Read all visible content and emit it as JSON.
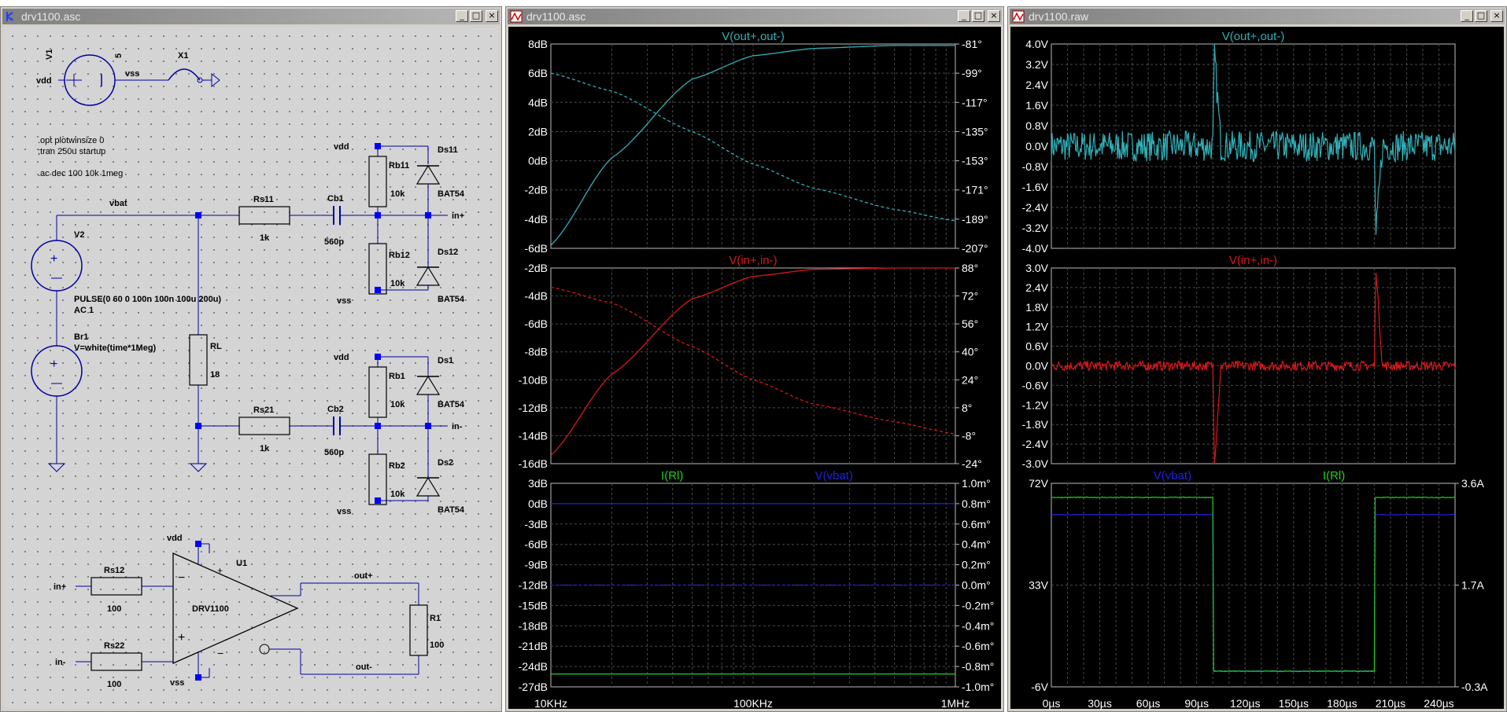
{
  "windows": {
    "schematic": {
      "title": "drv1100.asc"
    },
    "ac_plot": {
      "title": "drv1100.asc"
    },
    "tran_plot": {
      "title": "drv1100.raw"
    }
  },
  "title_buttons": {
    "minimize": "_",
    "maximize": "□",
    "close": "×"
  },
  "schematic": {
    "v1": {
      "name": "V1",
      "value": "5",
      "left_net": "vdd",
      "right_net": "vss"
    },
    "x1": {
      "name": "X1"
    },
    "directives": [
      ".opt plotwinsize 0",
      ";tran 250u startup",
      ".ac dec 100 10k 1meg"
    ],
    "v2": {
      "name": "V2",
      "value1": "PULSE(0 60 0 100n 100n 100u 200u)",
      "value2": "AC 1"
    },
    "br1": {
      "name": "Br1",
      "value": "V=white(time*1Meg)"
    },
    "rl": {
      "name": "RL",
      "value": "18"
    },
    "nets": {
      "vbat": "vbat",
      "inp": "in+",
      "inn": "in-",
      "outp": "out+",
      "outn": "out-"
    },
    "rs11": {
      "name": "Rs11",
      "value": "1k"
    },
    "cb1": {
      "name": "Cb1",
      "value": "560p"
    },
    "rb11": {
      "name": "Rb11",
      "value": "10k"
    },
    "rb12": {
      "name": "Rb12",
      "value": "10k"
    },
    "ds11": {
      "name": "Ds11",
      "value": "BAT54"
    },
    "ds12": {
      "name": "Ds12",
      "value": "BAT54"
    },
    "rs21": {
      "name": "Rs21",
      "value": "1k"
    },
    "cb2": {
      "name": "Cb2",
      "value": "560p"
    },
    "rb1": {
      "name": "Rb1",
      "value": "10k"
    },
    "rb2": {
      "name": "Rb2",
      "value": "10k"
    },
    "ds1": {
      "name": "Ds1",
      "value": "BAT54"
    },
    "ds2": {
      "name": "Ds2",
      "value": "BAT54"
    },
    "u1": {
      "name": "U1",
      "model": "DRV1100",
      "minus": "−",
      "plus": "+"
    },
    "rs12": {
      "name": "Rs12",
      "value": "100"
    },
    "rs22": {
      "name": "Rs22",
      "value": "100"
    },
    "r1": {
      "name": "R1",
      "value": "100"
    },
    "labels": {
      "vdd": "vdd",
      "vss": "vss"
    }
  },
  "colors": {
    "cyan": "#30b0b8",
    "red": "#d81818",
    "green": "#20d020",
    "blue": "#2020e0",
    "grid": "#4a4a4a",
    "axis_text": "#ffffff",
    "wire": "#0000a0",
    "junction": "#0000ff"
  },
  "ac_plot": {
    "panes": [
      {
        "traces": [
          {
            "name": "V(out+,out-)",
            "color": "#30b0b8"
          }
        ],
        "left_ticks": [
          "8dB",
          "6dB",
          "4dB",
          "2dB",
          "0dB",
          "-2dB",
          "-4dB",
          "-6dB"
        ],
        "right_ticks": [
          "-81°",
          "-99°",
          "-117°",
          "-135°",
          "-153°",
          "-171°",
          "-189°",
          "-207°"
        ]
      },
      {
        "traces": [
          {
            "name": "V(in+,in-)",
            "color": "#d81818"
          }
        ],
        "left_ticks": [
          "-2dB",
          "-4dB",
          "-6dB",
          "-8dB",
          "-10dB",
          "-12dB",
          "-14dB",
          "-16dB"
        ],
        "right_ticks": [
          "88°",
          "72°",
          "56°",
          "40°",
          "24°",
          "8°",
          "-8°",
          "-24°"
        ]
      },
      {
        "traces": [
          {
            "name": "I(Rl)",
            "color": "#20d020"
          },
          {
            "name": "V(vbat)",
            "color": "#2020e0"
          }
        ],
        "left_ticks": [
          "3dB",
          "0dB",
          "-3dB",
          "-6dB",
          "-9dB",
          "-12dB",
          "-15dB",
          "-18dB",
          "-21dB",
          "-24dB",
          "-27dB"
        ],
        "right_ticks": [
          "1.0m°",
          "0.8m°",
          "0.6m°",
          "0.4m°",
          "0.2m°",
          "0.0m°",
          "-0.2m°",
          "-0.4m°",
          "-0.6m°",
          "-0.8m°",
          "-1.0m°"
        ]
      }
    ],
    "x_ticks": [
      "10KHz",
      "100KHz",
      "1MHz"
    ],
    "chart_data": [
      {
        "type": "line",
        "xscale": "log",
        "x": [
          10000,
          20000,
          50000,
          100000,
          200000,
          500000,
          1000000
        ],
        "xlim": [
          10000,
          1000000
        ],
        "series": [
          {
            "name": "V(out+,out-)",
            "axis": "magnitude_dB",
            "values": [
              -5.8,
              0.2,
              5.6,
              7.2,
              7.7,
              7.9,
              7.9
            ]
          },
          {
            "name": "V(out+,out-)",
            "axis": "phase_deg",
            "style": "dashed",
            "values": [
              -99,
              -110,
              -135,
              -155,
              -170,
              -183,
              -190
            ]
          }
        ],
        "ylim": [
          -6,
          8
        ],
        "y2lim": [
          -207,
          -81
        ]
      },
      {
        "type": "line",
        "xscale": "log",
        "x": [
          10000,
          20000,
          50000,
          100000,
          200000,
          500000,
          1000000
        ],
        "xlim": [
          10000,
          1000000
        ],
        "series": [
          {
            "name": "V(in+,in-)",
            "axis": "magnitude_dB",
            "values": [
              -15.4,
              -9.6,
              -4.2,
              -2.6,
              -2.1,
              -2.0,
              -2.0
            ]
          },
          {
            "name": "V(in+,in-)",
            "axis": "phase_deg",
            "style": "dashed",
            "values": [
              77,
              68,
              43,
              24,
              10,
              0,
              -7
            ]
          }
        ],
        "ylim": [
          -16,
          -2
        ],
        "y2lim": [
          -24,
          88
        ]
      },
      {
        "type": "line",
        "xscale": "log",
        "x": [
          10000,
          1000000
        ],
        "xlim": [
          10000,
          1000000
        ],
        "series": [
          {
            "name": "I(Rl)",
            "axis": "magnitude_dB",
            "values": [
              -25.1,
              -25.1
            ]
          },
          {
            "name": "V(vbat)",
            "axis": "magnitude_dB",
            "values": [
              0,
              0
            ]
          },
          {
            "name": "V(vbat)",
            "axis": "phase_deg",
            "style": "dashed",
            "values": [
              0,
              0
            ]
          }
        ],
        "ylim": [
          -27,
          3
        ],
        "y2lim": [
          -0.001,
          0.001
        ]
      }
    ]
  },
  "tran_plot": {
    "panes": [
      {
        "traces": [
          {
            "name": "V(out+,out-)",
            "color": "#30b0b8"
          }
        ],
        "left_ticks": [
          "4.0V",
          "3.2V",
          "2.4V",
          "1.6V",
          "0.8V",
          "0.0V",
          "-0.8V",
          "-1.6V",
          "-2.4V",
          "-3.2V",
          "-4.0V"
        ]
      },
      {
        "traces": [
          {
            "name": "V(in+,in-)",
            "color": "#d81818"
          }
        ],
        "left_ticks": [
          "3.0V",
          "2.4V",
          "1.8V",
          "1.2V",
          "0.6V",
          "0.0V",
          "-0.6V",
          "-1.2V",
          "-1.8V",
          "-2.4V",
          "-3.0V"
        ]
      },
      {
        "traces": [
          {
            "name": "V(vbat)",
            "color": "#2020e0"
          },
          {
            "name": "I(Rl)",
            "color": "#20d020"
          }
        ],
        "left_ticks": [
          "72V",
          "33V",
          "-6V"
        ],
        "right_ticks": [
          "3.6A",
          "1.7A",
          "-0.3A"
        ]
      }
    ],
    "x_ticks": [
      "0µs",
      "30µs",
      "60µs",
      "90µs",
      "120µs",
      "150µs",
      "180µs",
      "210µs",
      "240µs"
    ],
    "chart_data": [
      {
        "type": "line",
        "x": [
          0,
          100,
          101,
          105,
          200,
          201,
          205,
          250
        ],
        "xlim": [
          0,
          250
        ],
        "series": [
          {
            "name": "V(out+,out-)",
            "values": [
              0,
              0,
              3.6,
              0,
              0,
              -3.6,
              0,
              0
            ],
            "noise": 0.6
          }
        ],
        "ylim": [
          -4,
          4
        ]
      },
      {
        "type": "line",
        "x": [
          0,
          100,
          101,
          105,
          200,
          201,
          205,
          250
        ],
        "xlim": [
          0,
          250
        ],
        "series": [
          {
            "name": "V(in+,in-)",
            "values": [
              0,
              0,
              -3.0,
              0,
              0,
              3.0,
              0,
              0
            ],
            "noise": 0.15
          }
        ],
        "ylim": [
          -3,
          3
        ]
      },
      {
        "type": "line",
        "x": [
          0,
          100,
          100.1,
          200,
          200.1,
          250
        ],
        "xlim": [
          0,
          250
        ],
        "series": [
          {
            "name": "V(vbat)",
            "values": [
              60,
              60,
              0,
              0,
              60,
              60
            ]
          },
          {
            "name": "I(Rl)",
            "values": [
              3.33,
              3.33,
              0,
              0,
              3.33,
              3.33
            ]
          }
        ],
        "ylim": [
          -6,
          72
        ],
        "y2lim": [
          -0.3,
          3.6
        ]
      }
    ]
  }
}
